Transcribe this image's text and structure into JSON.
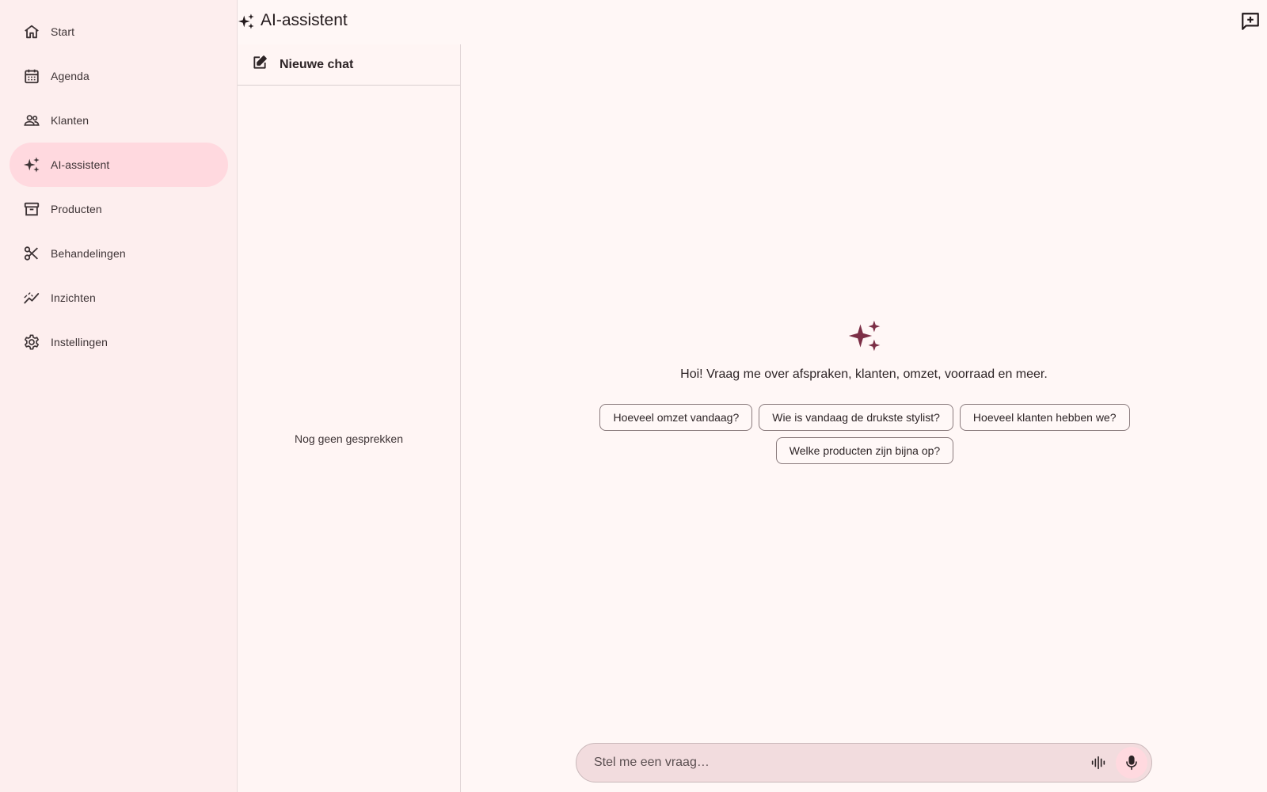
{
  "app": {
    "title": "AI-assistent"
  },
  "colors": {
    "accent": "#7c2f46",
    "active_nav": "#ffd9df",
    "sidebar_bg": "#fdeeee",
    "page_bg": "#fff7f6"
  },
  "sidebar": {
    "items": [
      {
        "label": "Start",
        "icon": "home-icon",
        "active": false
      },
      {
        "label": "Agenda",
        "icon": "calendar-icon",
        "active": false
      },
      {
        "label": "Klanten",
        "icon": "people-icon",
        "active": false
      },
      {
        "label": "AI-assistent",
        "icon": "sparkle-icon",
        "active": true
      },
      {
        "label": "Producten",
        "icon": "archive-box-icon",
        "active": false
      },
      {
        "label": "Behandelingen",
        "icon": "scissors-icon",
        "active": false
      },
      {
        "label": "Inzichten",
        "icon": "trend-icon",
        "active": false
      },
      {
        "label": "Instellingen",
        "icon": "gear-icon",
        "active": false
      }
    ]
  },
  "history": {
    "new_chat_label": "Nieuwe chat",
    "empty_text": "Nog geen gesprekken"
  },
  "main": {
    "greeting": "Hoi! Vraag me over afspraken, klanten, omzet, voorraad en meer.",
    "suggestions": [
      "Hoeveel omzet vandaag?",
      "Wie is vandaag de drukste stylist?",
      "Hoeveel klanten hebben we?",
      "Welke producten zijn bijna op?"
    ],
    "input_placeholder": "Stel me een vraag…"
  }
}
